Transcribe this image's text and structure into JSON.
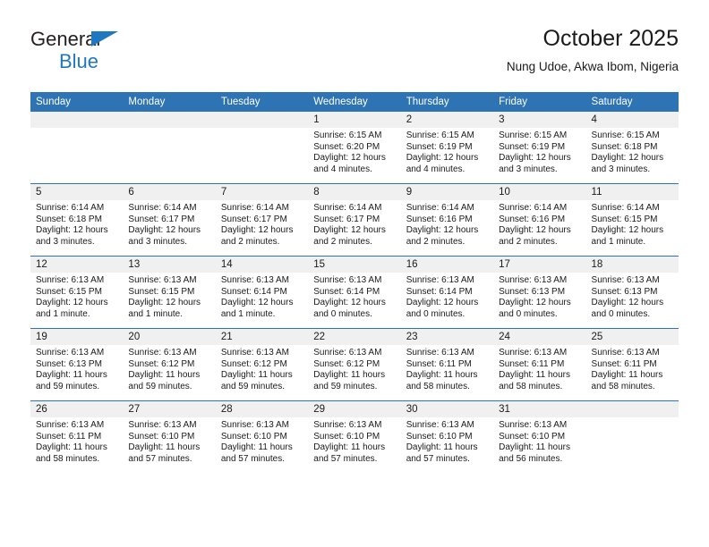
{
  "brand": {
    "line1": "General",
    "line2": "Blue",
    "accent_color": "#1F77C2",
    "text_color": "#231f20"
  },
  "header": {
    "title": "October 2025",
    "subtitle": "Nung Udoe, Akwa Ibom, Nigeria"
  },
  "theme": {
    "header_blue": "#2E74B5",
    "daynum_band": "#F0F0F0",
    "text": "#1a1a1a",
    "page_background": "#ffffff"
  },
  "weekday_headers": [
    "Sunday",
    "Monday",
    "Tuesday",
    "Wednesday",
    "Thursday",
    "Friday",
    "Saturday"
  ],
  "weeks": [
    [
      {
        "day": "",
        "empty": true,
        "sunrise": "",
        "sunset": "",
        "daylight_line1": "",
        "daylight_line2": ""
      },
      {
        "day": "",
        "empty": true,
        "sunrise": "",
        "sunset": "",
        "daylight_line1": "",
        "daylight_line2": ""
      },
      {
        "day": "",
        "empty": true,
        "sunrise": "",
        "sunset": "",
        "daylight_line1": "",
        "daylight_line2": ""
      },
      {
        "day": "1",
        "empty": false,
        "sunrise": "Sunrise: 6:15 AM",
        "sunset": "Sunset: 6:20 PM",
        "daylight_line1": "Daylight: 12 hours",
        "daylight_line2": "and 4 minutes."
      },
      {
        "day": "2",
        "empty": false,
        "sunrise": "Sunrise: 6:15 AM",
        "sunset": "Sunset: 6:19 PM",
        "daylight_line1": "Daylight: 12 hours",
        "daylight_line2": "and 4 minutes."
      },
      {
        "day": "3",
        "empty": false,
        "sunrise": "Sunrise: 6:15 AM",
        "sunset": "Sunset: 6:19 PM",
        "daylight_line1": "Daylight: 12 hours",
        "daylight_line2": "and 3 minutes."
      },
      {
        "day": "4",
        "empty": false,
        "sunrise": "Sunrise: 6:15 AM",
        "sunset": "Sunset: 6:18 PM",
        "daylight_line1": "Daylight: 12 hours",
        "daylight_line2": "and 3 minutes."
      }
    ],
    [
      {
        "day": "5",
        "empty": false,
        "sunrise": "Sunrise: 6:14 AM",
        "sunset": "Sunset: 6:18 PM",
        "daylight_line1": "Daylight: 12 hours",
        "daylight_line2": "and 3 minutes."
      },
      {
        "day": "6",
        "empty": false,
        "sunrise": "Sunrise: 6:14 AM",
        "sunset": "Sunset: 6:17 PM",
        "daylight_line1": "Daylight: 12 hours",
        "daylight_line2": "and 3 minutes."
      },
      {
        "day": "7",
        "empty": false,
        "sunrise": "Sunrise: 6:14 AM",
        "sunset": "Sunset: 6:17 PM",
        "daylight_line1": "Daylight: 12 hours",
        "daylight_line2": "and 2 minutes."
      },
      {
        "day": "8",
        "empty": false,
        "sunrise": "Sunrise: 6:14 AM",
        "sunset": "Sunset: 6:17 PM",
        "daylight_line1": "Daylight: 12 hours",
        "daylight_line2": "and 2 minutes."
      },
      {
        "day": "9",
        "empty": false,
        "sunrise": "Sunrise: 6:14 AM",
        "sunset": "Sunset: 6:16 PM",
        "daylight_line1": "Daylight: 12 hours",
        "daylight_line2": "and 2 minutes."
      },
      {
        "day": "10",
        "empty": false,
        "sunrise": "Sunrise: 6:14 AM",
        "sunset": "Sunset: 6:16 PM",
        "daylight_line1": "Daylight: 12 hours",
        "daylight_line2": "and 2 minutes."
      },
      {
        "day": "11",
        "empty": false,
        "sunrise": "Sunrise: 6:14 AM",
        "sunset": "Sunset: 6:15 PM",
        "daylight_line1": "Daylight: 12 hours",
        "daylight_line2": "and 1 minute."
      }
    ],
    [
      {
        "day": "12",
        "empty": false,
        "sunrise": "Sunrise: 6:13 AM",
        "sunset": "Sunset: 6:15 PM",
        "daylight_line1": "Daylight: 12 hours",
        "daylight_line2": "and 1 minute."
      },
      {
        "day": "13",
        "empty": false,
        "sunrise": "Sunrise: 6:13 AM",
        "sunset": "Sunset: 6:15 PM",
        "daylight_line1": "Daylight: 12 hours",
        "daylight_line2": "and 1 minute."
      },
      {
        "day": "14",
        "empty": false,
        "sunrise": "Sunrise: 6:13 AM",
        "sunset": "Sunset: 6:14 PM",
        "daylight_line1": "Daylight: 12 hours",
        "daylight_line2": "and 1 minute."
      },
      {
        "day": "15",
        "empty": false,
        "sunrise": "Sunrise: 6:13 AM",
        "sunset": "Sunset: 6:14 PM",
        "daylight_line1": "Daylight: 12 hours",
        "daylight_line2": "and 0 minutes."
      },
      {
        "day": "16",
        "empty": false,
        "sunrise": "Sunrise: 6:13 AM",
        "sunset": "Sunset: 6:14 PM",
        "daylight_line1": "Daylight: 12 hours",
        "daylight_line2": "and 0 minutes."
      },
      {
        "day": "17",
        "empty": false,
        "sunrise": "Sunrise: 6:13 AM",
        "sunset": "Sunset: 6:13 PM",
        "daylight_line1": "Daylight: 12 hours",
        "daylight_line2": "and 0 minutes."
      },
      {
        "day": "18",
        "empty": false,
        "sunrise": "Sunrise: 6:13 AM",
        "sunset": "Sunset: 6:13 PM",
        "daylight_line1": "Daylight: 12 hours",
        "daylight_line2": "and 0 minutes."
      }
    ],
    [
      {
        "day": "19",
        "empty": false,
        "sunrise": "Sunrise: 6:13 AM",
        "sunset": "Sunset: 6:13 PM",
        "daylight_line1": "Daylight: 11 hours",
        "daylight_line2": "and 59 minutes."
      },
      {
        "day": "20",
        "empty": false,
        "sunrise": "Sunrise: 6:13 AM",
        "sunset": "Sunset: 6:12 PM",
        "daylight_line1": "Daylight: 11 hours",
        "daylight_line2": "and 59 minutes."
      },
      {
        "day": "21",
        "empty": false,
        "sunrise": "Sunrise: 6:13 AM",
        "sunset": "Sunset: 6:12 PM",
        "daylight_line1": "Daylight: 11 hours",
        "daylight_line2": "and 59 minutes."
      },
      {
        "day": "22",
        "empty": false,
        "sunrise": "Sunrise: 6:13 AM",
        "sunset": "Sunset: 6:12 PM",
        "daylight_line1": "Daylight: 11 hours",
        "daylight_line2": "and 59 minutes."
      },
      {
        "day": "23",
        "empty": false,
        "sunrise": "Sunrise: 6:13 AM",
        "sunset": "Sunset: 6:11 PM",
        "daylight_line1": "Daylight: 11 hours",
        "daylight_line2": "and 58 minutes."
      },
      {
        "day": "24",
        "empty": false,
        "sunrise": "Sunrise: 6:13 AM",
        "sunset": "Sunset: 6:11 PM",
        "daylight_line1": "Daylight: 11 hours",
        "daylight_line2": "and 58 minutes."
      },
      {
        "day": "25",
        "empty": false,
        "sunrise": "Sunrise: 6:13 AM",
        "sunset": "Sunset: 6:11 PM",
        "daylight_line1": "Daylight: 11 hours",
        "daylight_line2": "and 58 minutes."
      }
    ],
    [
      {
        "day": "26",
        "empty": false,
        "sunrise": "Sunrise: 6:13 AM",
        "sunset": "Sunset: 6:11 PM",
        "daylight_line1": "Daylight: 11 hours",
        "daylight_line2": "and 58 minutes."
      },
      {
        "day": "27",
        "empty": false,
        "sunrise": "Sunrise: 6:13 AM",
        "sunset": "Sunset: 6:10 PM",
        "daylight_line1": "Daylight: 11 hours",
        "daylight_line2": "and 57 minutes."
      },
      {
        "day": "28",
        "empty": false,
        "sunrise": "Sunrise: 6:13 AM",
        "sunset": "Sunset: 6:10 PM",
        "daylight_line1": "Daylight: 11 hours",
        "daylight_line2": "and 57 minutes."
      },
      {
        "day": "29",
        "empty": false,
        "sunrise": "Sunrise: 6:13 AM",
        "sunset": "Sunset: 6:10 PM",
        "daylight_line1": "Daylight: 11 hours",
        "daylight_line2": "and 57 minutes."
      },
      {
        "day": "30",
        "empty": false,
        "sunrise": "Sunrise: 6:13 AM",
        "sunset": "Sunset: 6:10 PM",
        "daylight_line1": "Daylight: 11 hours",
        "daylight_line2": "and 57 minutes."
      },
      {
        "day": "31",
        "empty": false,
        "sunrise": "Sunrise: 6:13 AM",
        "sunset": "Sunset: 6:10 PM",
        "daylight_line1": "Daylight: 11 hours",
        "daylight_line2": "and 56 minutes."
      },
      {
        "day": "",
        "empty": true,
        "sunrise": "",
        "sunset": "",
        "daylight_line1": "",
        "daylight_line2": ""
      }
    ]
  ]
}
